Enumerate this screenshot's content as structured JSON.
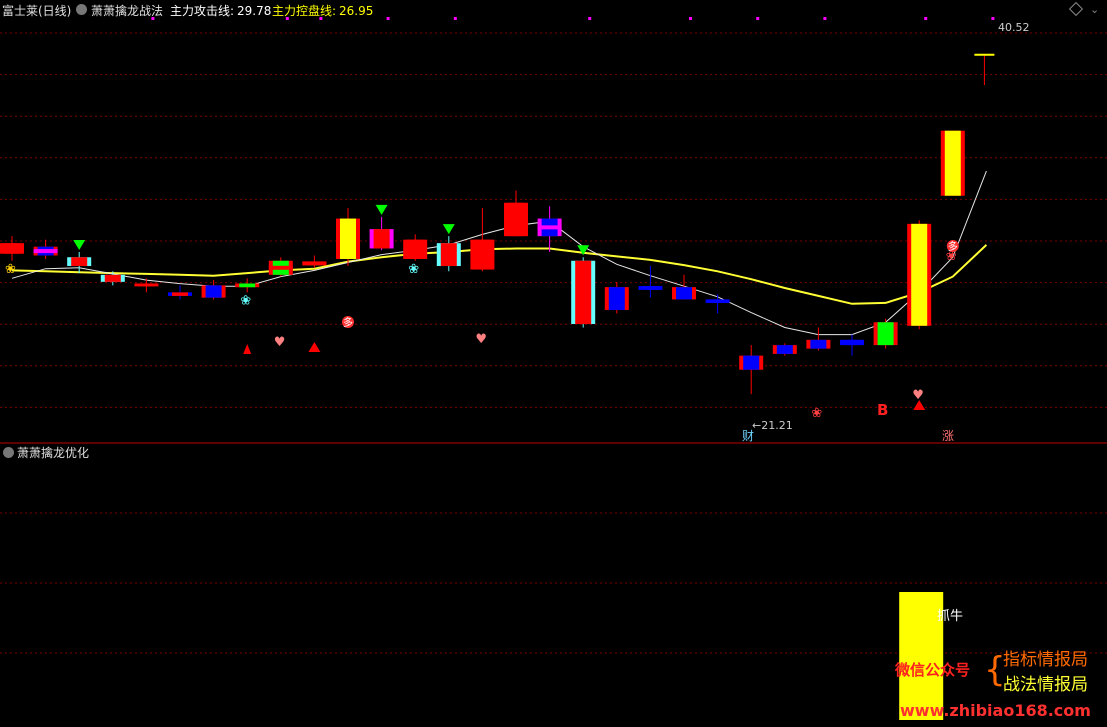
{
  "header": {
    "stock_name": "富士莱(日线)",
    "indicator_name": "萧萧擒龙战法",
    "attack_line_label": "主力攻击线:",
    "attack_line_value": "29.78",
    "control_line_label": "主力控盘线:",
    "control_line_value": "26.95",
    "lower_panel_title": "萧萧擒龙优化"
  },
  "colors": {
    "background": "#000000",
    "grid": "#7a0000",
    "divider": "#c00000",
    "up": "#ff0000",
    "down": "#0000ff",
    "cyan": "#66ffff",
    "yellow": "#ffff00",
    "magenta": "#ff00ff",
    "green": "#00ff00",
    "white_line": "#e6e6e6",
    "yellow_line": "#ffff33"
  },
  "chart_data": {
    "type": "candlestick",
    "ylim": [
      18.6,
      42.5
    ],
    "price_labels": {
      "high": "40.52",
      "low": "21.21"
    },
    "candles": [
      {
        "o": 29.8,
        "c": 29.2,
        "h": 30.2,
        "l": 28.8,
        "fill": "red",
        "edge": "red"
      },
      {
        "o": 29.1,
        "c": 29.6,
        "h": 30.0,
        "l": 28.9,
        "fill": "blue",
        "edge": "red",
        "band": "magenta"
      },
      {
        "o": 28.5,
        "c": 29.0,
        "h": 29.3,
        "l": 28.1,
        "fill": "red",
        "edge": "cyan"
      },
      {
        "o": 28.0,
        "c": 27.6,
        "h": 28.2,
        "l": 27.4,
        "fill": "red",
        "edge": "cyan"
      },
      {
        "o": 27.45,
        "c": 27.4,
        "h": 27.8,
        "l": 27.0,
        "fill": "red",
        "edge": "red"
      },
      {
        "o": 27.0,
        "c": 26.8,
        "h": 27.4,
        "l": 26.6,
        "fill": "red",
        "edge": "blue"
      },
      {
        "o": 26.7,
        "c": 27.4,
        "h": 27.7,
        "l": 26.6,
        "fill": "blue",
        "edge": "red"
      },
      {
        "o": 27.45,
        "c": 27.35,
        "h": 27.8,
        "l": 27.0,
        "fill": "green",
        "edge": "red"
      },
      {
        "o": 28.0,
        "c": 28.8,
        "h": 29.0,
        "l": 27.9,
        "fill": "green",
        "edge": "red",
        "band": "red"
      },
      {
        "o": 28.6,
        "c": 28.7,
        "h": 29.1,
        "l": 28.4,
        "fill": "green",
        "edge": "red",
        "band": "red"
      },
      {
        "o": 28.9,
        "c": 31.2,
        "h": 31.8,
        "l": 28.5,
        "fill": "yellow",
        "edge": "red"
      },
      {
        "o": 30.6,
        "c": 29.5,
        "h": 31.3,
        "l": 29.4,
        "fill": "red",
        "edge": "magenta"
      },
      {
        "o": 30.0,
        "c": 28.9,
        "h": 30.3,
        "l": 28.8,
        "fill": "red",
        "edge": "red"
      },
      {
        "o": 29.8,
        "c": 28.5,
        "h": 30.2,
        "l": 28.2,
        "fill": "red",
        "edge": "cyan"
      },
      {
        "o": 30.0,
        "c": 28.3,
        "h": 31.8,
        "l": 28.2,
        "fill": "red",
        "edge": "red"
      },
      {
        "o": 32.1,
        "c": 30.2,
        "h": 32.8,
        "l": 30.2,
        "fill": "red",
        "edge": "red"
      },
      {
        "o": 30.2,
        "c": 31.2,
        "h": 31.9,
        "l": 29.3,
        "fill": "blue",
        "edge": "magenta",
        "band": "magenta"
      },
      {
        "o": 28.8,
        "c": 25.2,
        "h": 29.0,
        "l": 25.0,
        "fill": "red",
        "edge": "cyan"
      },
      {
        "o": 26.0,
        "c": 27.3,
        "h": 27.6,
        "l": 25.8,
        "fill": "blue",
        "edge": "red"
      },
      {
        "o": 27.2,
        "c": 27.3,
        "h": 28.5,
        "l": 26.7,
        "fill": "blue",
        "edge": "blue"
      },
      {
        "o": 26.6,
        "c": 27.3,
        "h": 28.0,
        "l": 26.6,
        "fill": "blue",
        "edge": "red"
      },
      {
        "o": 26.6,
        "c": 26.4,
        "h": 26.9,
        "l": 25.8,
        "fill": "blue",
        "edge": "blue"
      },
      {
        "o": 22.6,
        "c": 23.4,
        "h": 24.0,
        "l": 21.21,
        "fill": "blue",
        "edge": "red"
      },
      {
        "o": 23.5,
        "c": 24.0,
        "h": 24.1,
        "l": 23.4,
        "fill": "blue",
        "edge": "red"
      },
      {
        "o": 23.8,
        "c": 24.3,
        "h": 25.0,
        "l": 23.7,
        "fill": "blue",
        "edge": "red"
      },
      {
        "o": 24.0,
        "c": 24.3,
        "h": 24.6,
        "l": 23.4,
        "fill": "blue",
        "edge": "blue"
      },
      {
        "o": 24.0,
        "c": 25.3,
        "h": 25.5,
        "l": 23.8,
        "fill": "green",
        "edge": "red"
      },
      {
        "o": 25.1,
        "c": 30.9,
        "h": 31.1,
        "l": 24.9,
        "fill": "yellow",
        "edge": "red"
      },
      {
        "o": 32.5,
        "c": 36.2,
        "h": 36.2,
        "l": 32.5,
        "fill": "yellow",
        "edge": "red"
      }
    ],
    "attack_line": [
      27.8,
      28.35,
      28.4,
      28.05,
      27.7,
      27.5,
      27.35,
      27.35,
      27.9,
      28.25,
      28.7,
      29.15,
      29.4,
      29.7,
      30.3,
      30.8,
      31.05,
      29.6,
      28.6,
      27.95,
      27.35,
      26.75,
      25.85,
      25.0,
      24.6,
      24.6,
      25.3,
      27.0,
      29.0,
      33.9
    ],
    "control_line": [
      28.25,
      28.2,
      28.15,
      28.1,
      28.05,
      28.0,
      27.95,
      28.1,
      28.25,
      28.35,
      28.75,
      29.0,
      29.2,
      29.3,
      29.45,
      29.5,
      29.5,
      29.25,
      29.05,
      28.85,
      28.55,
      28.2,
      27.75,
      27.25,
      26.8,
      26.35,
      26.4,
      27.0,
      27.9,
      29.7
    ],
    "signals": {
      "top_dots_slots": [
        4,
        8,
        9,
        11,
        13,
        17,
        20,
        22,
        24,
        27,
        29
      ],
      "lower_volume_bar": {
        "slot": 27,
        "label": "抓牛"
      }
    }
  },
  "markers": {
    "duo": "多",
    "cai": "财",
    "zhang": "涨",
    "b": "B"
  },
  "watermark": {
    "wechat": "微信公众号",
    "brace": "{",
    "line1": "指标情报局",
    "line2": "战法情报局",
    "url": "www.zhibiao168.com"
  }
}
